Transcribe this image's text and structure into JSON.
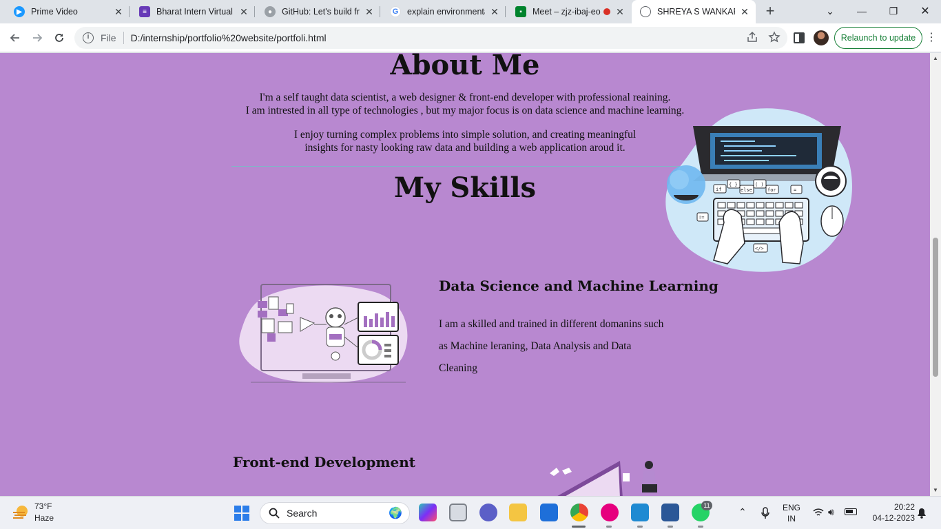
{
  "browser": {
    "tabs": [
      {
        "title": "Prime Video",
        "icon": "prime-video-icon",
        "color": "#1a98ff"
      },
      {
        "title": "Bharat Intern Virtual I",
        "icon": "forms-icon",
        "color": "#673ab7"
      },
      {
        "title": "GitHub: Let's build fro",
        "icon": "github-icon",
        "color": "#24292f"
      },
      {
        "title": "explain environmenta",
        "icon": "google-icon",
        "color": "#4285f4"
      },
      {
        "title": "Meet – zjz-ibaj-eo",
        "icon": "meet-icon",
        "color": "#00832d"
      },
      {
        "title": "SHREYA S WANKAR",
        "icon": "globe-icon",
        "color": "#5f6368"
      }
    ],
    "address": {
      "scheme_label": "File",
      "url": "D:/internship/portfolio%20website/portfoli.html"
    },
    "relaunch_label": "Relaunch to update"
  },
  "page": {
    "about_heading": "About Me",
    "about_line1": "I'm a self taught data scientist, a web designer & front-end developer with professional reaining.",
    "about_line2": "I am intrested in all type of technologies , but my major focus is on data science and machine learning.",
    "about_line3": "I enjoy turning complex problems into simple solution, and creating meaningful",
    "about_line4": "insights for nasty looking raw data and building a web application aroud it.",
    "skills_heading": "My Skills",
    "skills": [
      {
        "title": "Data Science and Machine Learning",
        "desc_line1": "I am a skilled and trained in different domanins such",
        "desc_line2": "as Machine leraning, Data Analysis and Data",
        "desc_line3": "Cleaning"
      },
      {
        "title": "Front-end Development"
      }
    ],
    "laptop_keys": [
      "if",
      "{ }",
      "else",
      "( )",
      "for",
      "=",
      "!=",
      "</>"
    ]
  },
  "taskbar": {
    "weather_temp": "73°F",
    "weather_cond": "Haze",
    "search_label": "Search",
    "whatsapp_badge": "11",
    "lang_top": "ENG",
    "lang_bottom": "IN",
    "time": "20:22",
    "date": "04-12-2023"
  }
}
